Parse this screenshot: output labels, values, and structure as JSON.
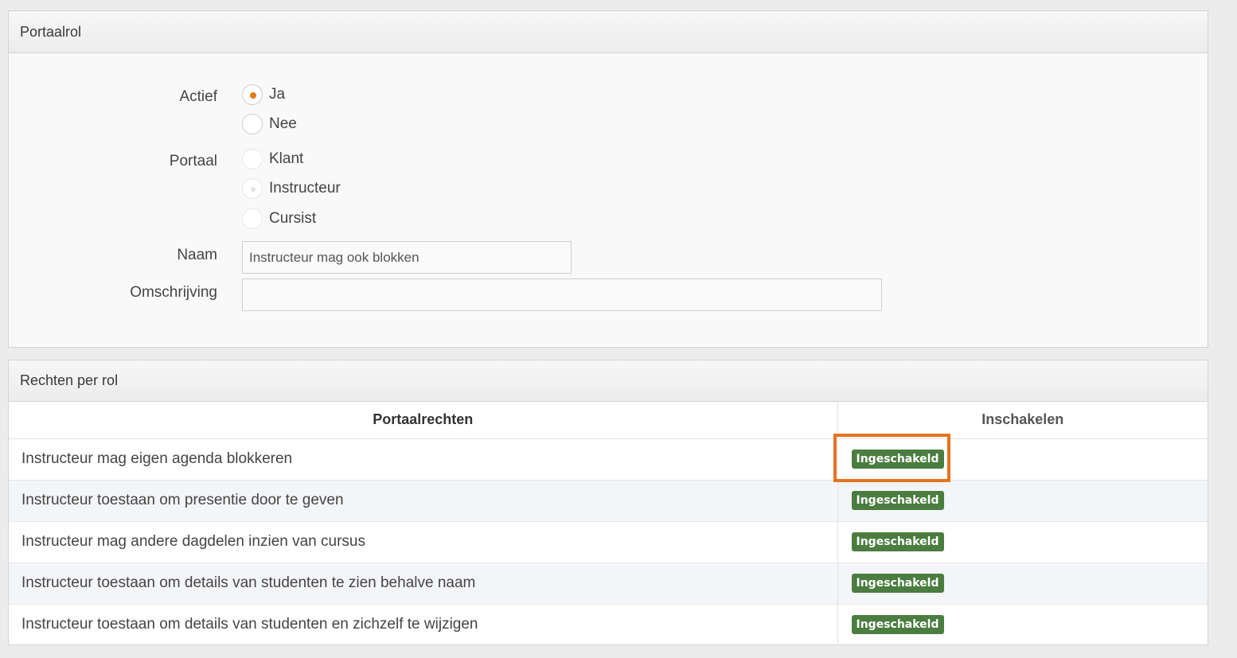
{
  "portaalrol": {
    "title": "Portaalrol",
    "actief_label": "Actief",
    "actief_options": [
      "Ja",
      "Nee"
    ],
    "actief_selected": "Ja",
    "portaal_label": "Portaal",
    "portaal_options": [
      "Klant",
      "Instructeur",
      "Cursist"
    ],
    "portaal_selected": "Instructeur",
    "naam_label": "Naam",
    "naam_value": "Instructeur mag ook blokken",
    "omschrijving_label": "Omschrijving",
    "omschrijving_value": ""
  },
  "rechten": {
    "title": "Rechten per rol",
    "col_rights": "Portaalrechten",
    "col_enable": "Inschakelen",
    "rows": [
      {
        "name": "Instructeur mag eigen agenda blokkeren",
        "status": "Ingeschakeld"
      },
      {
        "name": "Instructeur toestaan om presentie door te geven",
        "status": "Ingeschakeld"
      },
      {
        "name": "Instructeur mag andere dagdelen inzien van cursus",
        "status": "Ingeschakeld"
      },
      {
        "name": "Instructeur toestaan om details van studenten te zien behalve naam",
        "status": "Ingeschakeld"
      },
      {
        "name": "Instructeur toestaan om details van studenten en zichzelf te wijzigen",
        "status": "Ingeschakeld"
      }
    ]
  },
  "colors": {
    "accent": "#e07b1a",
    "badge": "#4a7d3f",
    "highlight": "#e3731f"
  }
}
